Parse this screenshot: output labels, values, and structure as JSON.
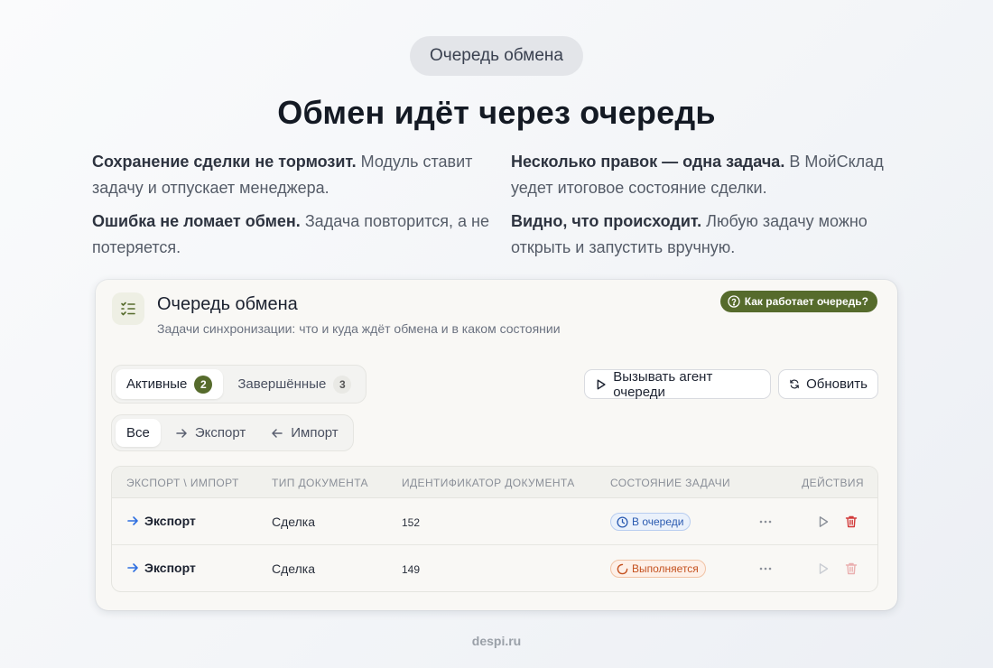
{
  "top_pill": "Очередь обмена",
  "headline": "Обмен идёт через очередь",
  "features": [
    {
      "bold": "Сохранение сделки не тормозит.",
      "text": " Модуль ставит задачу и отпускает менеджера."
    },
    {
      "bold": "Несколько правок — одна задача.",
      "text": " В МойСклад уедет итоговое состояние сделки."
    },
    {
      "bold": "Ошибка не ломает обмен.",
      "text": " Задача повторится, а не потеряется."
    },
    {
      "bold": "Видно, что происходит.",
      "text": " Любую задачу можно открыть и запустить вручную."
    }
  ],
  "card": {
    "icon": "checklist-icon",
    "title": "Очередь обмена",
    "subtitle": "Задачи синхронизации: что и куда ждёт обмена и в каком состоянии",
    "help_button": "Как работает очередь?",
    "tabs": [
      {
        "label": "Активные",
        "count": "2",
        "active": true
      },
      {
        "label": "Завершённые",
        "count": "3",
        "active": false
      }
    ],
    "direction_filters": [
      {
        "label": "Все",
        "icon": "",
        "active": true
      },
      {
        "label": "Экспорт",
        "icon": "arrow-right-icon",
        "active": false
      },
      {
        "label": "Импорт",
        "icon": "arrow-left-icon",
        "active": false
      }
    ],
    "agent_button": "Вызывать агент очереди",
    "refresh_button": "Обновить"
  },
  "table": {
    "columns": [
      "ЭКСПОРТ \\ ИМПОРТ",
      "ТИП ДОКУМЕНТА",
      "ИДЕНТИФИКАТОР ДОКУМЕНТА",
      "СОСТОЯНИЕ ЗАДАЧИ",
      "ДЕЙСТВИЯ"
    ],
    "rows": [
      {
        "direction": "Экспорт",
        "doc_type": "Сделка",
        "doc_id": "152",
        "status": "В очереди",
        "status_kind": "queue"
      },
      {
        "direction": "Экспорт",
        "doc_type": "Сделка",
        "doc_id": "149",
        "status": "Выполняется",
        "status_kind": "running"
      }
    ]
  },
  "colors": {
    "accent": "#566b2c",
    "queue": "#2a5ab0",
    "running": "#c4511f",
    "delete": "#d23a3a",
    "export_arrow": "#2f6fe0"
  },
  "footer": "despi.ru"
}
